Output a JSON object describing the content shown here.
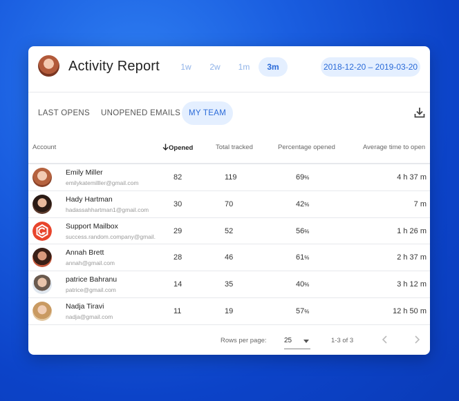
{
  "header": {
    "title": "Activity Report",
    "ranges": [
      "1w",
      "2w",
      "1m",
      "3m"
    ],
    "active_range": "3m",
    "date_range": "2018-12-20 – 2019-03-20"
  },
  "tabs": [
    "LAST OPENS",
    "UNOPENED EMAILS",
    "MY TEAM"
  ],
  "active_tab": "MY TEAM",
  "table": {
    "columns": {
      "account": "Account",
      "opened": "Opened",
      "total": "Total tracked",
      "pct": "Percentage opened",
      "avg": "Average time to open"
    },
    "rows": [
      {
        "name": "Emily Miller",
        "email": "emilykatemilller@gmail.com",
        "opened": "82",
        "total": "119",
        "pct": "69",
        "avg": "4 h 37 m"
      },
      {
        "name": "Hady Hartman",
        "email": "hadassahhartman1@gmail.com",
        "opened": "30",
        "total": "70",
        "pct": "42",
        "avg": "7 m"
      },
      {
        "name": "Support Mailbox",
        "email": "success.random.company@gmail.com",
        "opened": "29",
        "total": "52",
        "pct": "56",
        "avg": "1 h 26 m"
      },
      {
        "name": "Annah Brett",
        "email": "annah@gmail.com",
        "opened": "28",
        "total": "46",
        "pct": "61",
        "avg": "2 h 37 m"
      },
      {
        "name": "patrice Bahranu",
        "email": "patrice@gmail.com",
        "opened": "14",
        "total": "35",
        "pct": "40",
        "avg": "3 h 12 m"
      },
      {
        "name": "Nadja Tiravi",
        "email": "nadja@gmail.com",
        "opened": "11",
        "total": "19",
        "pct": "57",
        "avg": "12 h 50 m"
      }
    ],
    "pct_unit": "%"
  },
  "footer": {
    "rows_per_page_label": "Rows per page:",
    "rows_per_page": "25",
    "range_text": "1-3 of 3"
  },
  "colors": {
    "accent": "#2a6ad8",
    "accent_bg": "#e4efff",
    "background": "#1a5ee0"
  }
}
